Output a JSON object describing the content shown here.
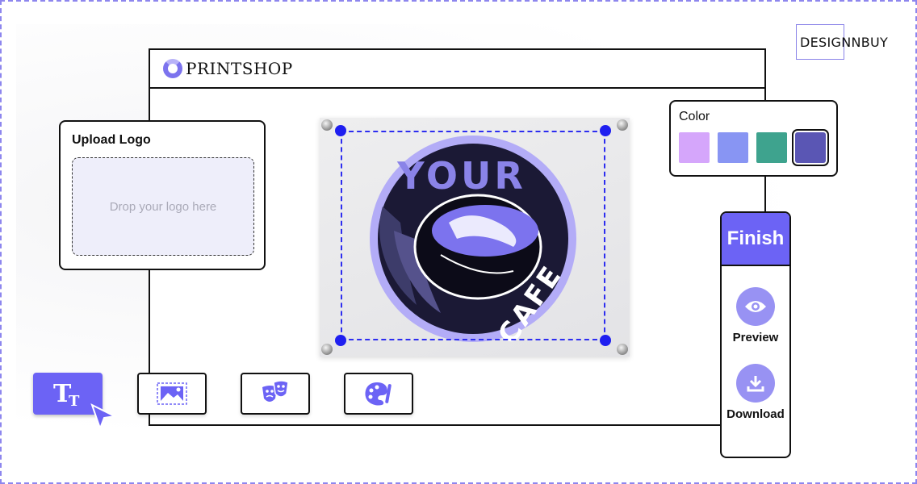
{
  "brand": {
    "name": "DESIGNNBUY"
  },
  "app": {
    "title": "PRINTSHOP"
  },
  "upload": {
    "title": "Upload Logo",
    "dropzone_text": "Drop your logo here"
  },
  "color": {
    "title": "Color",
    "swatches": [
      "#d5a6fb",
      "#8895f3",
      "#3ea38e",
      "#5a56b4"
    ],
    "selected_index": 3
  },
  "finish": {
    "label": "Finish"
  },
  "actions": {
    "preview_label": "Preview",
    "download_label": "Download"
  },
  "canvas": {
    "top_text": "YOUR",
    "bottom_text": "CAFE"
  },
  "toolbar": {
    "text_tool_glyph": "T",
    "text_tool_small_glyph": "T"
  },
  "colors": {
    "accent": "#6c63f5",
    "selection": "#1f1ff0",
    "frame_dash": "#8d86ee"
  }
}
